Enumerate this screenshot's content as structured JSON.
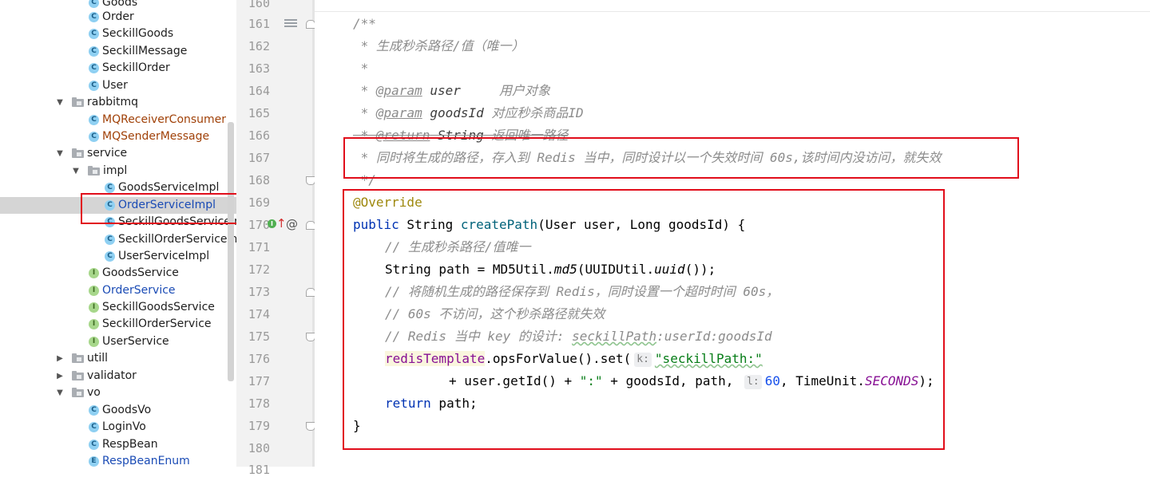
{
  "tree": {
    "items": [
      {
        "label": "Goods",
        "icon": "c"
      },
      {
        "label": "Order",
        "icon": "c"
      },
      {
        "label": "SeckillGoods",
        "icon": "c"
      },
      {
        "label": "SeckillMessage",
        "icon": "c"
      },
      {
        "label": "SeckillOrder",
        "icon": "c"
      },
      {
        "label": "User",
        "icon": "c"
      },
      {
        "label": "rabbitmq",
        "icon": "folder",
        "expanded": true
      },
      {
        "label": "MQReceiverConsumer",
        "icon": "c",
        "color": "brown"
      },
      {
        "label": "MQSenderMessage",
        "icon": "c",
        "color": "brown"
      },
      {
        "label": "service",
        "icon": "folder",
        "expanded": true
      },
      {
        "label": "impl",
        "icon": "folder",
        "expanded": true
      },
      {
        "label": "GoodsServiceImpl",
        "icon": "c"
      },
      {
        "label": "OrderServiceImpl",
        "icon": "c",
        "color": "blue",
        "selected": true
      },
      {
        "label": "SeckillGoodsServiceImp",
        "icon": "c"
      },
      {
        "label": "SeckillOrderServiceImpl",
        "icon": "c"
      },
      {
        "label": "UserServiceImpl",
        "icon": "c"
      },
      {
        "label": "GoodsService",
        "icon": "i"
      },
      {
        "label": "OrderService",
        "icon": "i",
        "color": "blue"
      },
      {
        "label": "SeckillGoodsService",
        "icon": "i"
      },
      {
        "label": "SeckillOrderService",
        "icon": "i"
      },
      {
        "label": "UserService",
        "icon": "i"
      },
      {
        "label": "utill",
        "icon": "folder",
        "expanded": false
      },
      {
        "label": "validator",
        "icon": "folder",
        "expanded": false
      },
      {
        "label": "vo",
        "icon": "folder",
        "expanded": true
      },
      {
        "label": "GoodsVo",
        "icon": "c"
      },
      {
        "label": "LoginVo",
        "icon": "c"
      },
      {
        "label": "RespBean",
        "icon": "c"
      },
      {
        "label": "RespBeanEnum",
        "icon": "e",
        "color": "blue"
      }
    ],
    "icon_letters": {
      "c": "C",
      "i": "I",
      "e": "E"
    }
  },
  "gutter": {
    "line_numbers": [
      "160",
      "161",
      "162",
      "163",
      "164",
      "165",
      "166",
      "167",
      "168",
      "169",
      "170",
      "171",
      "172",
      "173",
      "174",
      "175",
      "176",
      "177",
      "178",
      "179",
      "180",
      "181"
    ]
  },
  "code": {
    "l161": "/**",
    "l162": " * 生成秒杀路径/值（唯一）",
    "l163": " *",
    "l164_tag": "@param",
    "l164_name": "user",
    "l164_desc": "     用户对象",
    "l165_tag": "@param",
    "l165_name": "goodsId",
    "l165_desc": " 对应秒杀商品ID",
    "l166_tag": "@return",
    "l166_type": "String",
    "l166_desc": " 返回唯一路径",
    "l167": " * 同时将生成的路径，存入到 Redis 当中，同时设计以一个失效时间 60s,该时间内没访问，就失效",
    "l168": " */",
    "l169": "@Override",
    "l170_kw": "public",
    "l170_type": " String ",
    "l170_fn": "createPath",
    "l170_params": "(User user, Long goodsId) {",
    "l171": "// 生成秒杀路径/值唯一",
    "l172_a": "String path = MD5Util.",
    "l172_md5": "md5",
    "l172_b": "(UUIDUtil.",
    "l172_uuid": "uuid",
    "l172_c": "());",
    "l173": "// 将随机生成的路径保存到 Redis，同时设置一个超时时间 60s，",
    "l174": "// 60s 不访问，这个秒杀路径就失效",
    "l175_a": "// Redis 当中 key 的设计: ",
    "l175_b": "seckillPath",
    "l175_c": ":userId:goodsId",
    "l176_field": "redisTemplate",
    "l176_a": ".opsForValue().set(",
    "l176_hint": "k:",
    "l176_str": "\"seckillPath:\"",
    "l177_a": "+ user.getId() + ",
    "l177_str": "\":\"",
    "l177_b": " + goodsId, path, ",
    "l177_hint": "l:",
    "l177_num": "60",
    "l177_c": ", TimeUnit.",
    "l177_const": "SECONDS",
    "l177_d": ");",
    "l178_kw": "return",
    "l178_rest": " path;",
    "l179": "}"
  },
  "colors": {
    "highlight_box": "#e10e1b",
    "selection": "#d5d5d5"
  }
}
